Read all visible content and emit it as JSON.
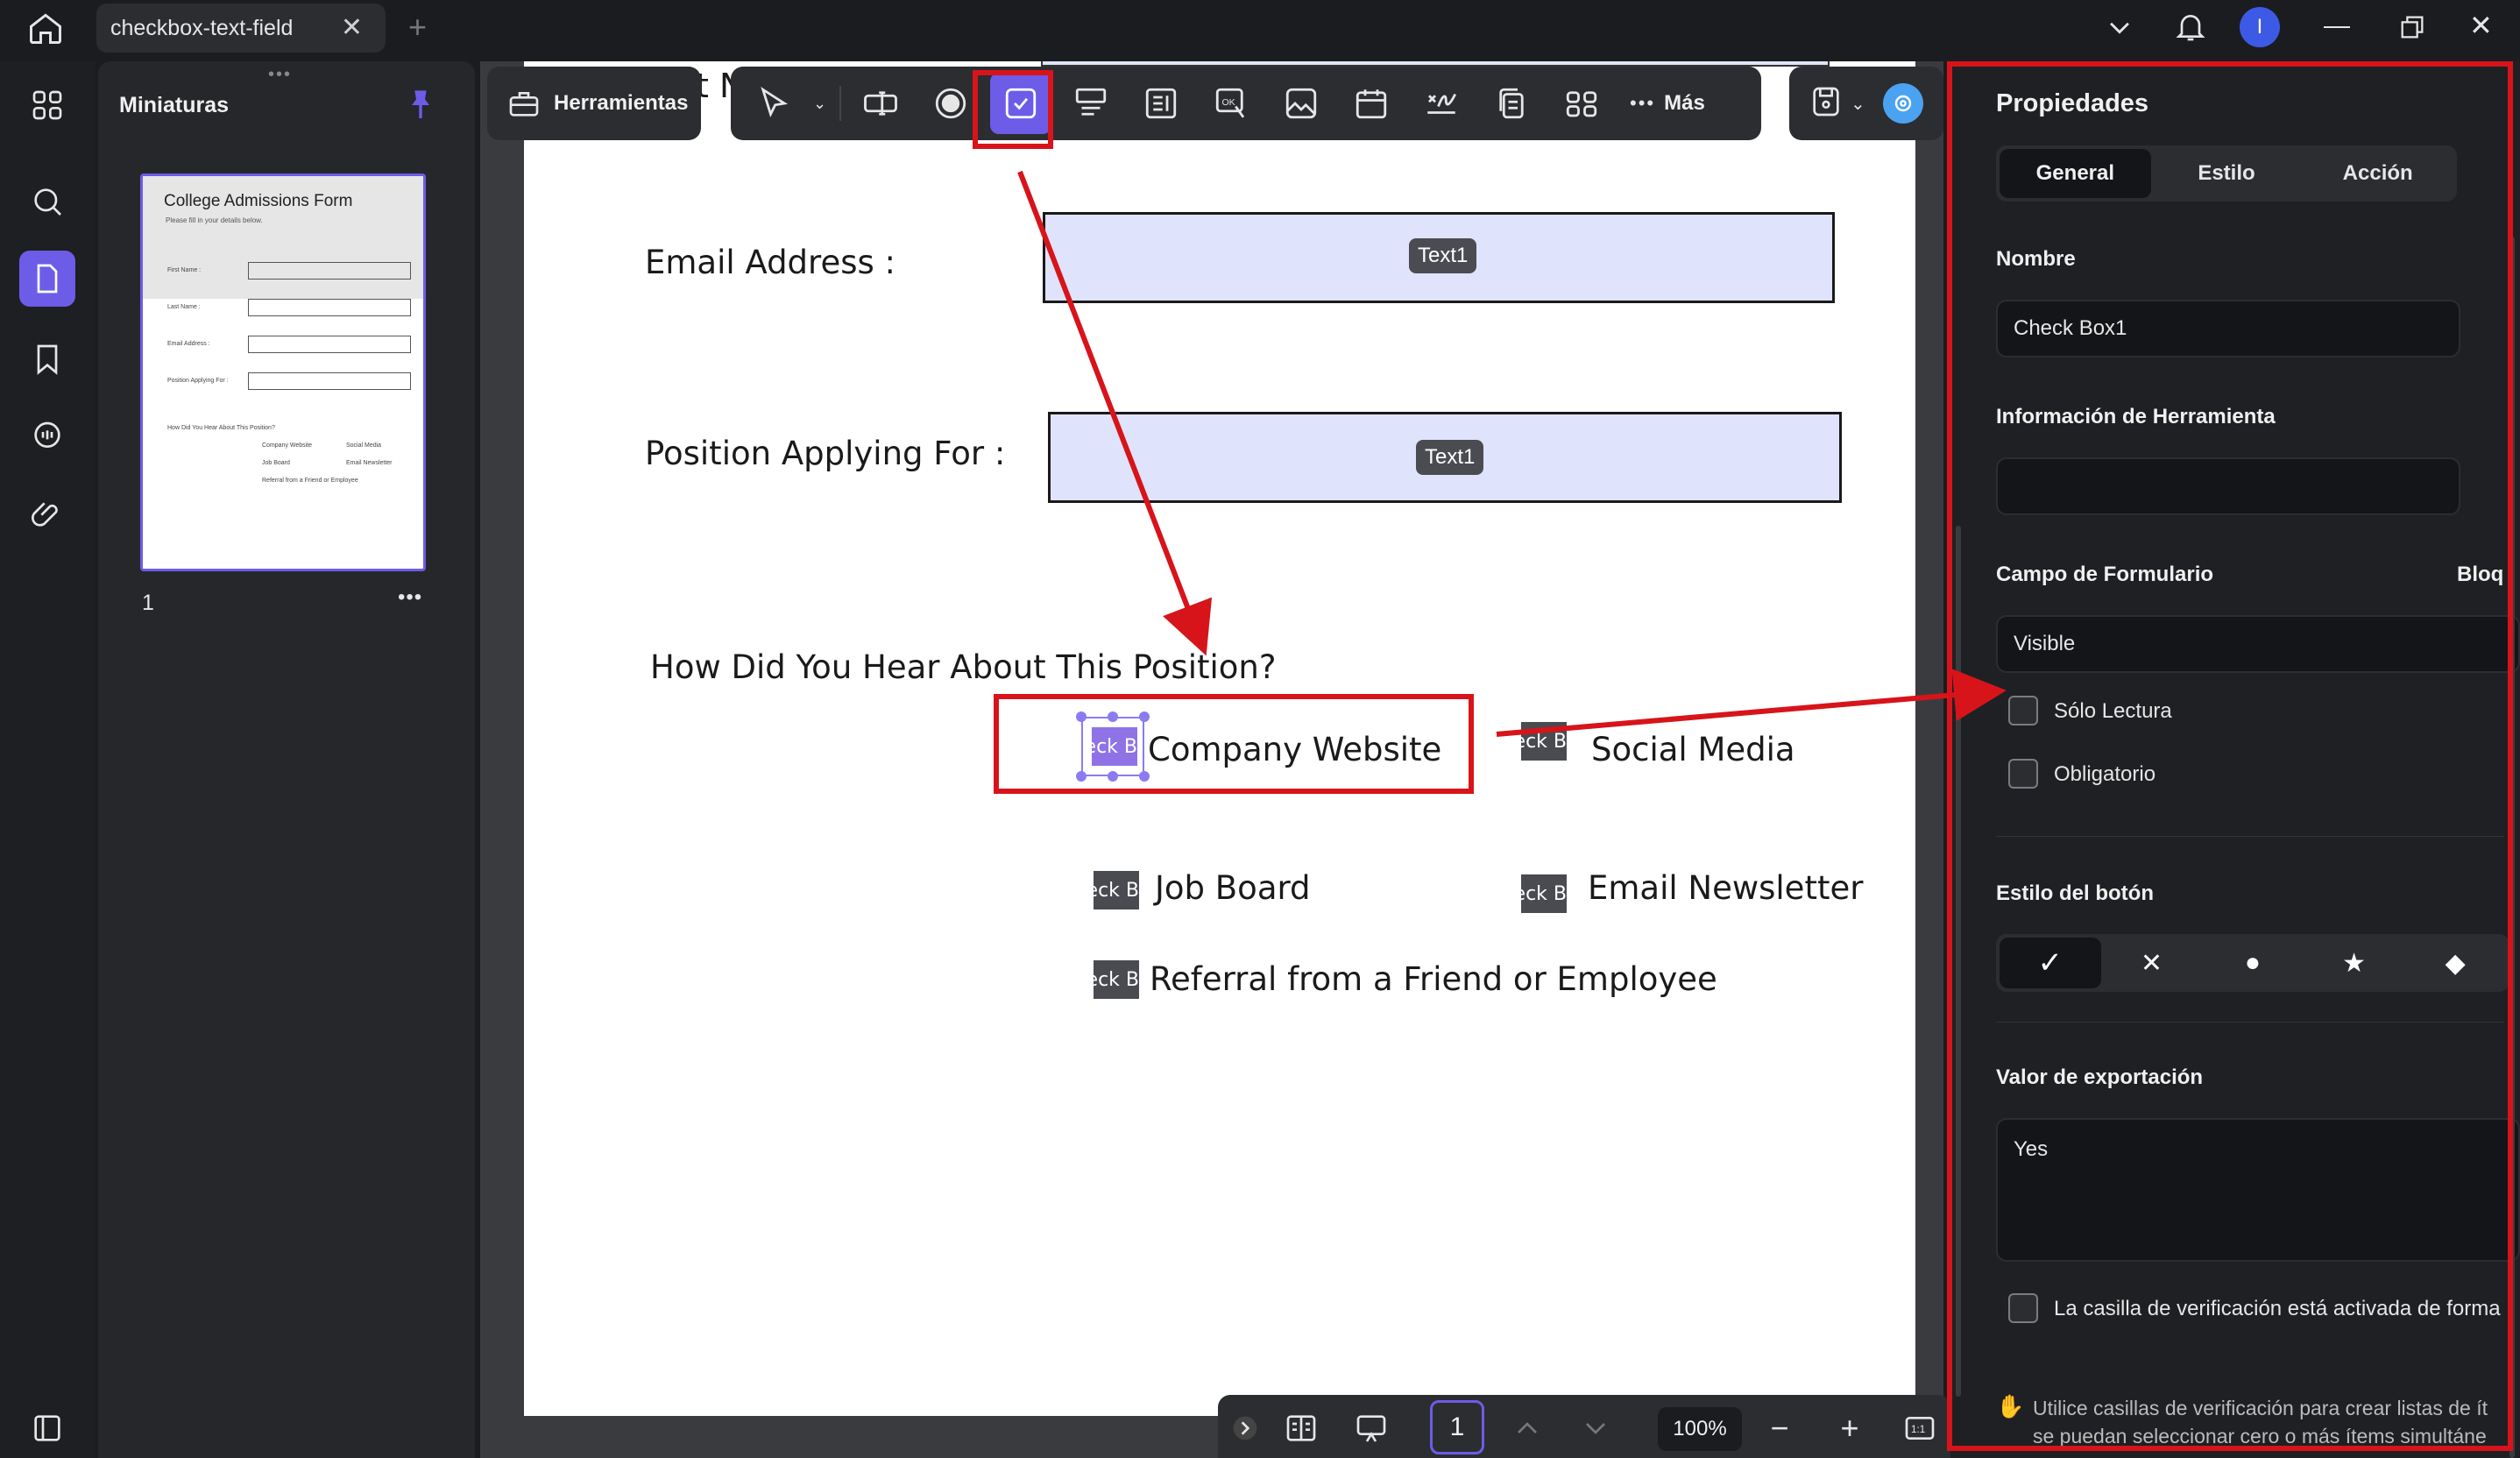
{
  "tab": {
    "title": "checkbox-text-field"
  },
  "thumbnails": {
    "title": "Miniaturas",
    "page_number": "1",
    "preview_title": "College Admissions Form",
    "preview_subtitle": "Please fill in your details below.",
    "preview_fields": [
      "First Name :",
      "Last Name :",
      "Email Address :",
      "Position Applying For :"
    ],
    "preview_question": "How Did You Hear About This Position?",
    "preview_options": [
      "Company Website",
      "Social Media",
      "Job Board",
      "Email Newsletter",
      "Referral from a Friend or Employee"
    ]
  },
  "toolbar": {
    "tools_label": "Herramientas",
    "more_label": "Más"
  },
  "document": {
    "partial_top_text": "t N",
    "email_label": "Email Address :",
    "email_field_tag": "Text1",
    "position_label": "Position Applying For :",
    "position_field_tag": "Text1",
    "question": "How Did You Hear About This Position?",
    "checkbox_tag": "eck B",
    "options": {
      "company_website": "Company Website",
      "social_media": "Social Media",
      "job_board": "Job Board",
      "email_newsletter": "Email Newsletter",
      "referral": "Referral from a Friend or Employee"
    }
  },
  "bottom_bar": {
    "page_value": "1",
    "zoom": "100%"
  },
  "properties": {
    "title": "Propiedades",
    "tabs": [
      "General",
      "Estilo",
      "Acción"
    ],
    "name_label": "Nombre",
    "name_value": "Check Box1",
    "tooltip_label": "Información de Herramienta",
    "tooltip_value": "",
    "form_field_label": "Campo de Formulario",
    "lock_label": "Bloq",
    "visibility_value": "Visible",
    "readonly_label": "Sólo Lectura",
    "required_label": "Obligatorio",
    "button_style_label": "Estilo del botón",
    "export_label": "Valor de exportación",
    "export_value": "Yes",
    "checked_default_label": "La casilla de verificación está activada de forma",
    "hint_line1": "Utilice casillas de verificación para crear listas de ít",
    "hint_line2": "se puedan seleccionar cero o más ítems simultáne"
  },
  "colors": {
    "accent": "#6d5ce8",
    "annotation_red": "#d7141a",
    "field_fill": "#dfe3fb"
  },
  "icons": [
    "home-icon",
    "grid-icon",
    "search-icon",
    "page-icon",
    "bookmark-icon",
    "comment-icon",
    "attachment-icon",
    "pin-icon",
    "select-arrow-icon",
    "textfield-icon",
    "radio-icon",
    "checkbox-icon",
    "combo-icon",
    "list-icon",
    "ok-button-icon",
    "image-icon",
    "calendar-icon",
    "signature-icon",
    "copy-icon",
    "apps-icon",
    "more-icon",
    "save-icon",
    "ai-icon",
    "bell-icon",
    "avatar"
  ]
}
